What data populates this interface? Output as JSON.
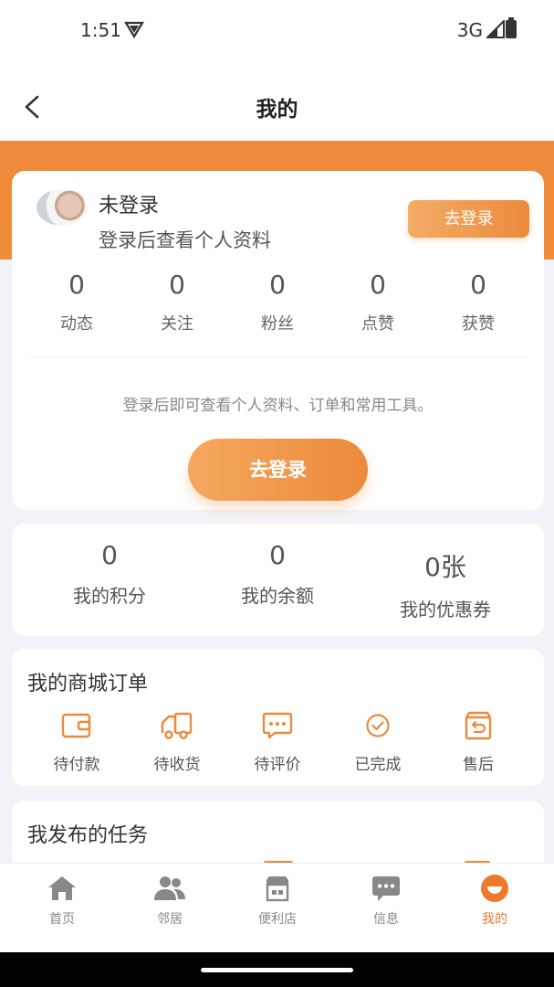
{
  "status": {
    "time": "1:51",
    "network": "3G"
  },
  "nav": {
    "title": "我的"
  },
  "profile": {
    "name": "未登录",
    "subtitle": "登录后查看个人资料",
    "login_small": "去登录",
    "stats": [
      {
        "value": "0",
        "label": "动态"
      },
      {
        "value": "0",
        "label": "关注"
      },
      {
        "value": "0",
        "label": "粉丝"
      },
      {
        "value": "0",
        "label": "点赞"
      },
      {
        "value": "0",
        "label": "获赞"
      }
    ],
    "hint": "登录后即可查看个人资料、订单和常用工具。",
    "login_big": "去登录"
  },
  "wallet": [
    {
      "value": "0",
      "label": "我的积分"
    },
    {
      "value": "0",
      "label": "我的余额"
    },
    {
      "value": "0张",
      "label": "我的优惠券"
    }
  ],
  "orders": {
    "title": "我的商城订单",
    "items": [
      {
        "label": "待付款",
        "icon": "wallet-icon"
      },
      {
        "label": "待收货",
        "icon": "truck-icon"
      },
      {
        "label": "待评价",
        "icon": "comment-icon"
      },
      {
        "label": "已完成",
        "icon": "check-circle-icon"
      },
      {
        "label": "售后",
        "icon": "return-icon"
      }
    ]
  },
  "tasks": {
    "title": "我发布的任务"
  },
  "tabs": [
    {
      "label": "首页",
      "icon": "home-icon"
    },
    {
      "label": "邻居",
      "icon": "people-icon"
    },
    {
      "label": "便利店",
      "icon": "store-icon"
    },
    {
      "label": "信息",
      "icon": "message-icon"
    },
    {
      "label": "我的",
      "icon": "me-icon"
    }
  ],
  "colors": {
    "accent": "#ec8a3c",
    "active_tab": "#ec7a2a"
  }
}
